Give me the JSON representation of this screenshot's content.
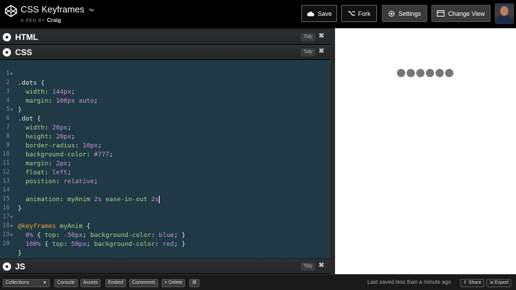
{
  "header": {
    "pen_title": "CSS Keyframes",
    "byline_prefix": "A PEN BY",
    "author": "Craig",
    "buttons": {
      "save": "Save",
      "fork": "Fork",
      "settings": "Settings",
      "change_view": "Change View"
    }
  },
  "panes": {
    "html": {
      "label": "HTML",
      "tidy": "Tidy"
    },
    "css": {
      "label": "CSS",
      "tidy": "Tidy"
    },
    "js": {
      "label": "JS",
      "tidy": "Tidy"
    }
  },
  "css_code": {
    "line_numbers": [
      "1",
      "2",
      "3",
      "4",
      "5",
      "6",
      "7",
      "8",
      "9",
      "10",
      "11",
      "12",
      "13",
      "14",
      "15",
      "16",
      "17",
      "18",
      "19",
      "20"
    ],
    "lines": [
      ".dots {",
      "  width: 144px;",
      "  margin: 100px auto;",
      "}",
      ".dot {",
      "  width: 20px;",
      "  height: 20px;",
      "  border-radius: 10px;",
      "  background-color: #777;",
      "  margin: 2px;",
      "  float: left;",
      "  position: relative;",
      "",
      "  animation: myAnim 2s ease-in-out 2s",
      "}",
      "",
      "@keyframes myAnim {",
      "  0% { top: -50px; background-color: blue; }",
      "  100% { top: 50px; background-color: red; }",
      "}"
    ]
  },
  "preview": {
    "dot_color": "#777777",
    "dot_count": 6
  },
  "footer": {
    "collections": "Collections",
    "console": "Console",
    "assets": "Assets",
    "embed": "Embed",
    "comments": "Comments",
    "delete": "× Delete",
    "shortcuts": "⌘",
    "saved_status": "Last saved less than a minute ago",
    "share": "Share",
    "export": "Export"
  },
  "colors": {
    "editor_bg": "#1f3a44",
    "property": "#a8d08d",
    "value": "#c78fd9",
    "at_rule": "#e6a14a"
  }
}
